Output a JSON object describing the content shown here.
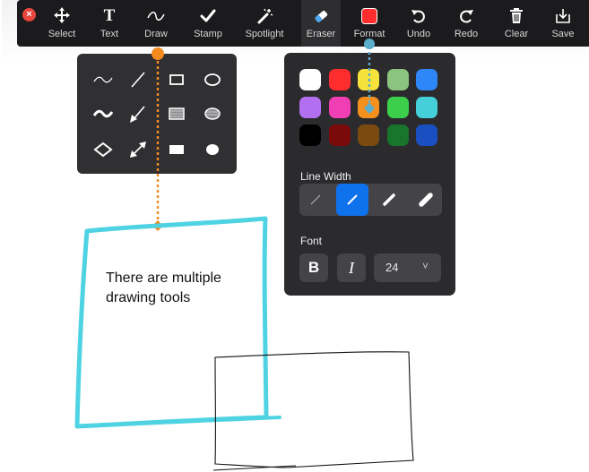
{
  "toolbar": {
    "tools": [
      {
        "label": "Select",
        "icon": "move-icon"
      },
      {
        "label": "Text",
        "icon": "text-t-icon"
      },
      {
        "label": "Draw",
        "icon": "squiggle-icon"
      },
      {
        "label": "Stamp",
        "icon": "checkmark-icon"
      },
      {
        "label": "Spotlight",
        "icon": "magic-wand-icon"
      },
      {
        "label": "Eraser",
        "icon": "eraser-icon"
      },
      {
        "label": "Format",
        "icon": "color-swatch-icon"
      },
      {
        "label": "Undo",
        "icon": "undo-icon"
      },
      {
        "label": "Redo",
        "icon": "redo-icon"
      },
      {
        "label": "Clear",
        "icon": "trash-icon"
      },
      {
        "label": "Save",
        "icon": "save-icon"
      }
    ],
    "format_color": "#ff2d2d",
    "close_glyph": "×"
  },
  "shapes_panel": {
    "items": [
      "freehand-thin-icon",
      "line-thin-icon",
      "rectangle-outline-thin-icon",
      "ellipse-outline-thin-icon",
      "freehand-thick-icon",
      "arrow-single-icon",
      "rectangle-semi-filled-icon",
      "ellipse-semi-filled-icon",
      "diamond-outline-icon",
      "arrow-double-icon",
      "rectangle-filled-icon",
      "ellipse-filled-icon"
    ]
  },
  "format_panel": {
    "colors": [
      "#ffffff",
      "#ff2d2d",
      "#f5e23a",
      "#8bc47e",
      "#2f86f6",
      "#b26ff0",
      "#f03fb5",
      "#f5901e",
      "#3ccf4c",
      "#45cfd9",
      "#000000",
      "#7b0a0a",
      "#7a4a10",
      "#19742c",
      "#1a4fc2"
    ],
    "selected_color_index": 7,
    "line_width_label": "Line Width",
    "line_width_selected_index": 1,
    "font_label": "Font",
    "bold_glyph": "B",
    "italic_glyph": "I",
    "font_size": "24",
    "font_size_chevron": "˅"
  },
  "canvas": {
    "note_line1": "There are multiple",
    "note_line2": "drawing tools",
    "accent_orange": "#f58a1f",
    "accent_blue": "#5aaecc",
    "box_color": "#4fd3e3"
  }
}
